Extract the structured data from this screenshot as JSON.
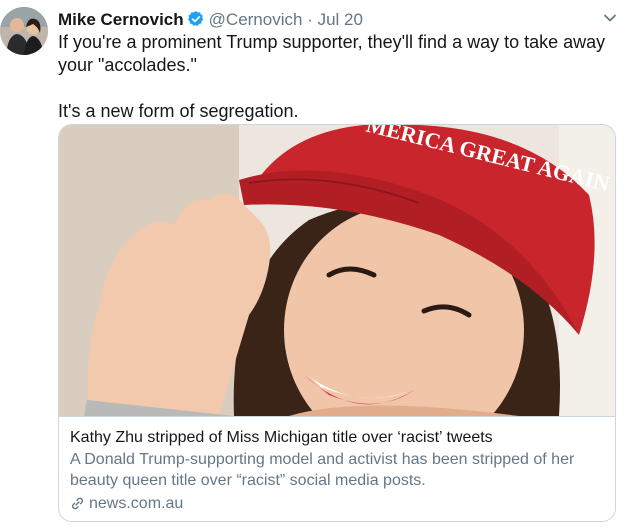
{
  "author": {
    "name": "Mike Cernovich",
    "handle": "@Cernovich",
    "separator": "·",
    "date": "Jul 20"
  },
  "tweet": {
    "line1": "If you're a prominent Trump supporter, they'll find a way to take away your \"accolades.\"",
    "line2": "It's a new form of segregation."
  },
  "card": {
    "image_hat_text": "MERICA GREAT AGAIN",
    "title": "Kathy Zhu stripped of Miss Michigan title over ‘racist’ tweets",
    "description": "A Donald Trump-supporting model and activist has been stripped of her beauty queen title over “racist” social media posts.",
    "domain": "news.com.au"
  },
  "colors": {
    "verified": "#1da1f2",
    "muted": "#657786",
    "border": "#ccd6dd",
    "hat_red": "#c8262c"
  },
  "icons": [
    "verified-badge-icon",
    "chevron-down-icon",
    "link-icon"
  ]
}
